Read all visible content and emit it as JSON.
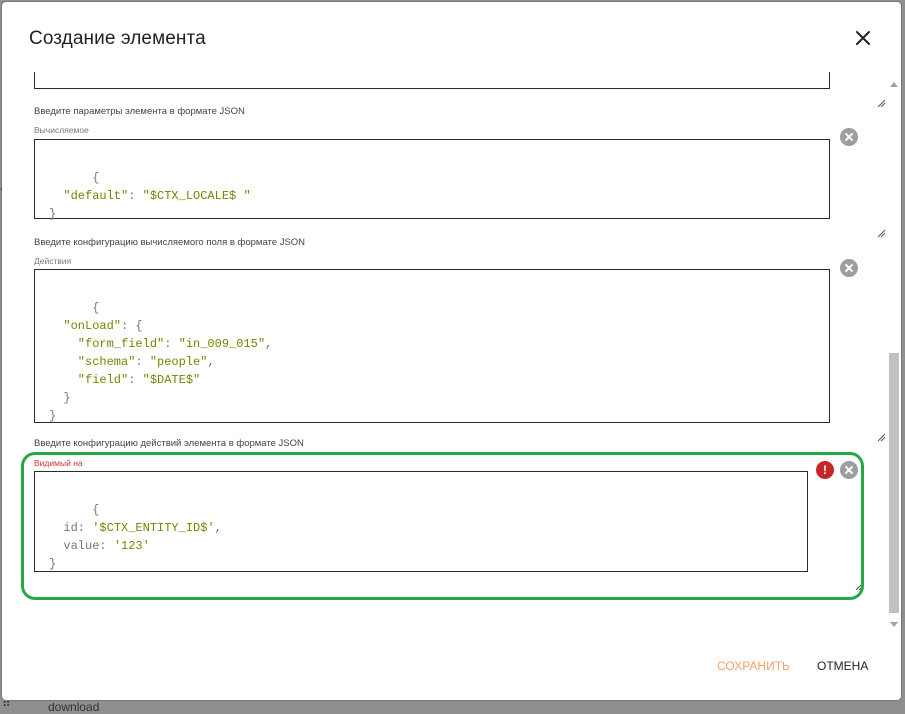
{
  "dialog": {
    "title": "Создание элемента",
    "close_icon": "close-icon"
  },
  "fields": {
    "params_label": "Введите параметры элемента в формате JSON",
    "computed": {
      "label": "Вычисляемое",
      "code": "{\n  \"default\": \"$CTX_LOCALE$ \"\n}"
    },
    "computed_config_label": "Введите конфигурацию вычисляемого поля в формате JSON",
    "actions": {
      "label": "Действия",
      "code": "{\n  \"onLoad\": {\n    \"form_field\": \"in_009_015\",\n    \"schema\": \"people\",\n    \"field\": \"$DATE$\"\n  }\n}"
    },
    "actions_config_label": "Введите конфигурацию действий элемента в формате JSON",
    "visible_on": {
      "label": "Видимый на",
      "code": "{\n  id: '$CTX_ENTITY_ID$',\n  value: '123'\n}",
      "error_icon": "!"
    }
  },
  "footer": {
    "save_label": "СОХРАНИТЬ",
    "cancel_label": "ОТМЕНА"
  },
  "background": {
    "peek_text": "download"
  },
  "colors": {
    "highlight": "#27a845",
    "save": "#f5a26a",
    "error": "#c62828",
    "json_value": "#6a8a00"
  }
}
